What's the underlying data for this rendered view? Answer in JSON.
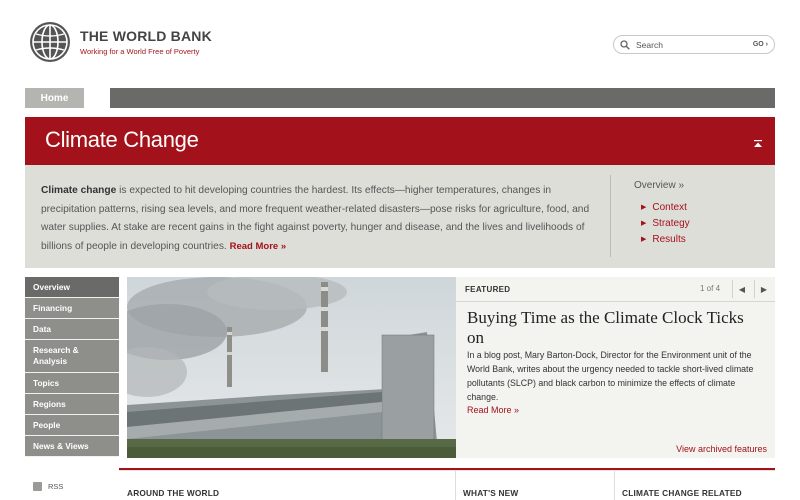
{
  "header": {
    "logo_title": "THE WORLD BANK",
    "logo_tagline": "Working for a World Free of Poverty",
    "search_placeholder": "Search",
    "search_go": "GO"
  },
  "nav": {
    "home": "Home"
  },
  "banner": {
    "title": "Climate Change"
  },
  "intro": {
    "lead": "Climate change",
    "text": " is expected to hit developing countries the hardest. Its effects—higher temperatures, changes in precipitation patterns, rising sea levels, and more frequent weather-related disasters—pose risks for agriculture, food, and water supplies. At stake are recent gains in the fight against poverty, hunger and disease, and the lives and livelihoods of billions of people in developing countries.",
    "read_more": "Read More »",
    "overview": "Overview »",
    "links": [
      "Context",
      "Strategy",
      "Results"
    ]
  },
  "sidebar": {
    "items": [
      {
        "label": "Overview"
      },
      {
        "label": "Financing"
      },
      {
        "label": "Data"
      },
      {
        "label": "Research & Analysis"
      },
      {
        "label": "Topics"
      },
      {
        "label": "Regions"
      },
      {
        "label": "People"
      },
      {
        "label": "News & Views"
      }
    ],
    "rss": "RSS"
  },
  "featured": {
    "label": "FEATURED",
    "pager": "1 of 4",
    "title": "Buying Time as the Climate Clock Ticks on",
    "body": "In a blog post, Mary Barton-Dock, Director for the Environment unit of the World Bank, writes about the urgency needed to tackle short-lived climate pollutants (SLCP) and black carbon to minimize the effects of climate change.",
    "read_more": "Read More »",
    "archive": "View archived features"
  },
  "bottom": {
    "col1": "AROUND THE WORLD",
    "col2": "WHAT'S NEW",
    "col3": "CLIMATE CHANGE RELATED"
  },
  "colors": {
    "brand_red": "#a3121a",
    "nav_gray": "#6a6b68",
    "intro_bg": "#deded9"
  }
}
